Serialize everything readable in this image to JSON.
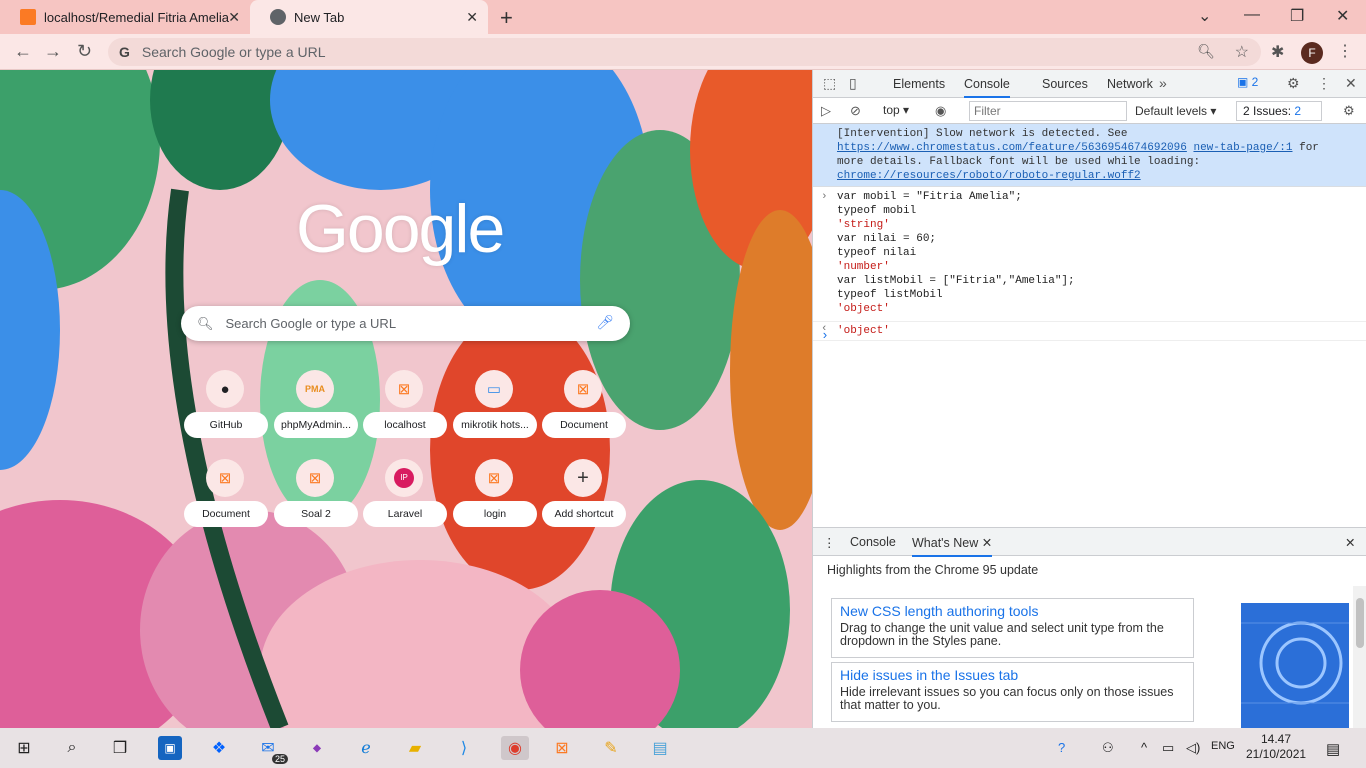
{
  "browser": {
    "tabs": [
      {
        "title": "localhost/Remedial Fitria Amelia"
      },
      {
        "title": "New Tab"
      }
    ],
    "omnibox_placeholder": "Search Google or type a URL",
    "avatar_letter": "F"
  },
  "ntp": {
    "logo": "Google",
    "search_placeholder": "Search Google or type a URL",
    "shortcuts": [
      {
        "label": "GitHub",
        "icon": "github-icon"
      },
      {
        "label": "phpMyAdmin...",
        "icon": "pma-icon"
      },
      {
        "label": "localhost",
        "icon": "xampp-icon"
      },
      {
        "label": "mikrotik hots...",
        "icon": "mikrotik-icon"
      },
      {
        "label": "Document",
        "icon": "xampp-icon"
      },
      {
        "label": "Document",
        "icon": "xampp-icon"
      },
      {
        "label": "Soal 2",
        "icon": "xampp-icon"
      },
      {
        "label": "Laravel",
        "icon": "ip-icon"
      },
      {
        "label": "login",
        "icon": "xampp-icon"
      },
      {
        "label": "Add shortcut",
        "icon": "plus-icon"
      }
    ]
  },
  "devtools": {
    "tabs": [
      "Elements",
      "Console",
      "Sources",
      "Network"
    ],
    "active_tab": "Console",
    "message_badge": "2",
    "context": "top",
    "filter_placeholder": "Filter",
    "levels": "Default levels",
    "issues_label": "2 Issues:",
    "issues_count": "2",
    "warning": {
      "prefix": "[Intervention] Slow network is detected. See",
      "link1": "https://www.chromestatus.com/feature/5636954674692096",
      "source": "new-tab-page/:1",
      "middle": "for more details. Fallback font will be used while loading:",
      "link2": "chrome://resources/roboto/roboto-regular.woff2"
    },
    "console_lines": [
      {
        "text": "var mobil = \"Fitria Amelia\";",
        "kind": "cmd"
      },
      {
        "text": "typeof mobil",
        "kind": "cmd"
      },
      {
        "text": "'string'",
        "kind": "str"
      },
      {
        "text": "var nilai = 60;",
        "kind": "cmd"
      },
      {
        "text": "typeof nilai",
        "kind": "cmd"
      },
      {
        "text": "'number'",
        "kind": "str"
      },
      {
        "text": "var listMobil = [\"Fitria\",\"Amelia\"];",
        "kind": "cmd"
      },
      {
        "text": "typeof listMobil",
        "kind": "cmd"
      },
      {
        "text": "'object'",
        "kind": "str"
      }
    ],
    "result": "'object'",
    "drawer": {
      "tabs": [
        "Console",
        "What's New"
      ],
      "title": "Highlights from the Chrome 95 update",
      "cards": [
        {
          "heading": "New CSS length authoring tools",
          "body": "Drag to change the unit value and select unit type from the dropdown in the Styles pane."
        },
        {
          "heading": "Hide issues in the Issues tab",
          "body": "Hide irrelevant issues so you can focus only on those issues that matter to you."
        }
      ]
    }
  },
  "taskbar": {
    "mail_badge": "25",
    "language": "ENG",
    "time": "14.47",
    "date": "21/10/2021"
  }
}
